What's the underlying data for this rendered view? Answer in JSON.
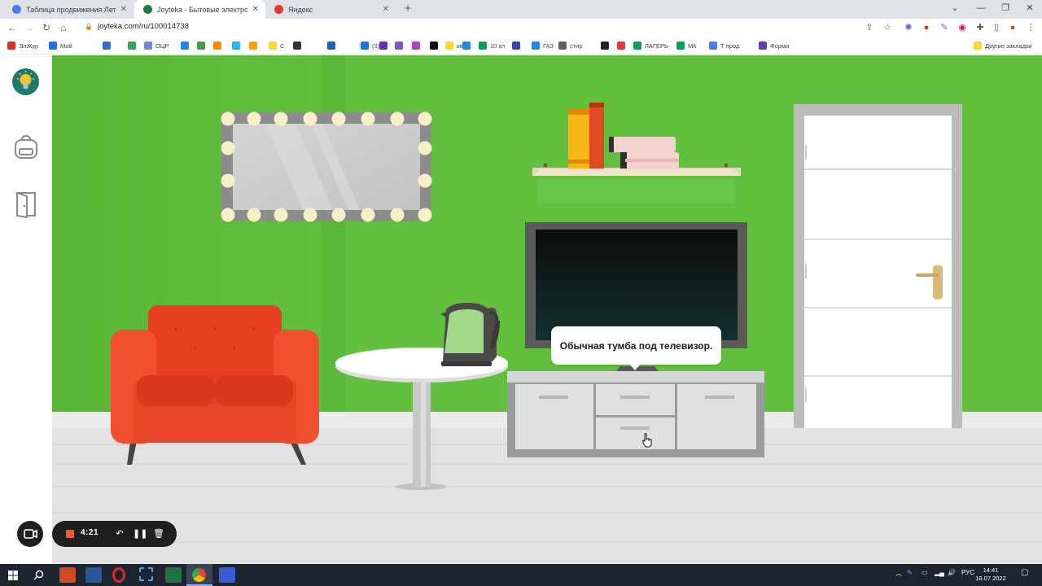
{
  "browser": {
    "tabs": [
      {
        "label": "Таблица продвижения Летний",
        "favicon_color": "#4a7cf0",
        "active": false
      },
      {
        "label": "Joyteka - Бытовые электроприб",
        "favicon_color": "#1f7a4c",
        "active": true
      },
      {
        "label": "Яндекс",
        "favicon_color": "#e33b2e",
        "active": false
      }
    ],
    "url": "joyteka.com/ru/100014738"
  },
  "bookmarks": [
    {
      "label": "ЭлЖур",
      "color": "#d93025"
    },
    {
      "label": "Мой",
      "color": "#1a73e8"
    },
    {
      "label": "",
      "color": "#2e6fd8"
    },
    {
      "label": "",
      "color": "#34a853"
    },
    {
      "label": "ОЦР",
      "color": "#6b8cd6"
    },
    {
      "label": "",
      "color": "#1e88e5"
    },
    {
      "label": "",
      "color": "#43a047"
    },
    {
      "label": "",
      "color": "#fb8c00"
    },
    {
      "label": "",
      "color": "#29b6f6"
    },
    {
      "label": "",
      "color": "#ffa000"
    },
    {
      "label": "С",
      "color": "#fdd835"
    },
    {
      "label": "",
      "color": "#333333"
    },
    {
      "label": "",
      "color": "#1565c0"
    },
    {
      "label": "(3)",
      "color": "#1976d2"
    },
    {
      "label": "",
      "color": "#5e35b1"
    },
    {
      "label": "",
      "color": "#7e57c2"
    },
    {
      "label": "",
      "color": "#ab47bc"
    },
    {
      "label": "",
      "color": "#111111"
    },
    {
      "label": "кв",
      "color": "#fdd835"
    },
    {
      "label": "",
      "color": "#1e88e5"
    },
    {
      "label": "10 кл",
      "color": "#0f9d58"
    },
    {
      "label": "",
      "color": "#3949ab"
    },
    {
      "label": "ГАЗ",
      "color": "#1e88e5"
    },
    {
      "label": "стир",
      "color": "#5f6368"
    },
    {
      "label": "",
      "color": "#222222"
    },
    {
      "label": "",
      "color": "#e53935"
    },
    {
      "label": "ЛАГЕРЬ",
      "color": "#0f9d58"
    },
    {
      "label": "МК",
      "color": "#0f9d58"
    },
    {
      "label": "Т прод",
      "color": "#4a7cf0"
    },
    {
      "label": "Форма",
      "color": "#673ab7"
    }
  ],
  "bookmarks_other": "Другие закладки",
  "scene": {
    "tooltip": "Обычная тумба под телевизор.",
    "wall_color": "#5fbe3c",
    "floor_color": "#e2e2e2"
  },
  "sidebar": {
    "icons": [
      "lightbulb-icon",
      "backpack-icon",
      "door-exit-icon"
    ]
  },
  "recorder": {
    "time": "4:21"
  },
  "taskbar": {
    "language": "РУС",
    "time": "14:41",
    "date": "18.07.2022"
  }
}
